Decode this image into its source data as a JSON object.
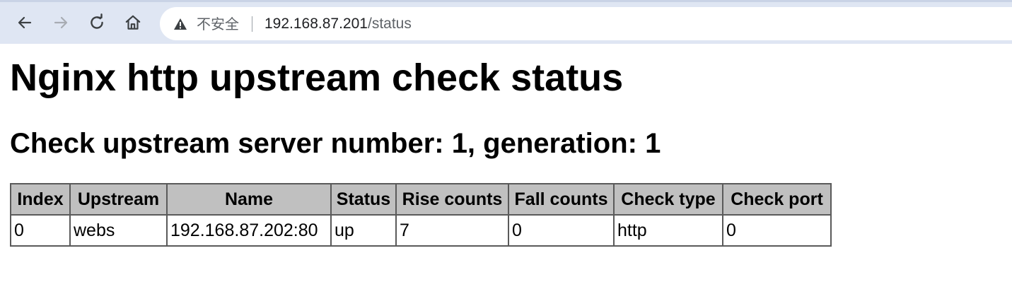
{
  "browser": {
    "nav": {
      "back_icon": "arrow-left-icon",
      "forward_icon": "arrow-right-icon",
      "reload_icon": "reload-icon",
      "home_icon": "home-icon"
    },
    "omnibox": {
      "security_icon": "warning-triangle-icon",
      "security_label": "不安全",
      "url_host": "192.168.87.201",
      "url_path": "/status"
    }
  },
  "page": {
    "title": "Nginx http upstream check status",
    "subtitle": "Check upstream server number: 1, generation: 1",
    "table": {
      "headers": [
        "Index",
        "Upstream",
        "Name",
        "Status",
        "Rise counts",
        "Fall counts",
        "Check type",
        "Check port"
      ],
      "rows": [
        [
          "0",
          "webs",
          "192.168.87.202:80",
          "up",
          "7",
          "0",
          "http",
          "0"
        ]
      ]
    }
  },
  "colors": {
    "toolbar_bg": "#dfe6f3",
    "header_bg": "#c0c0c0",
    "border": "#5a5a5a"
  }
}
